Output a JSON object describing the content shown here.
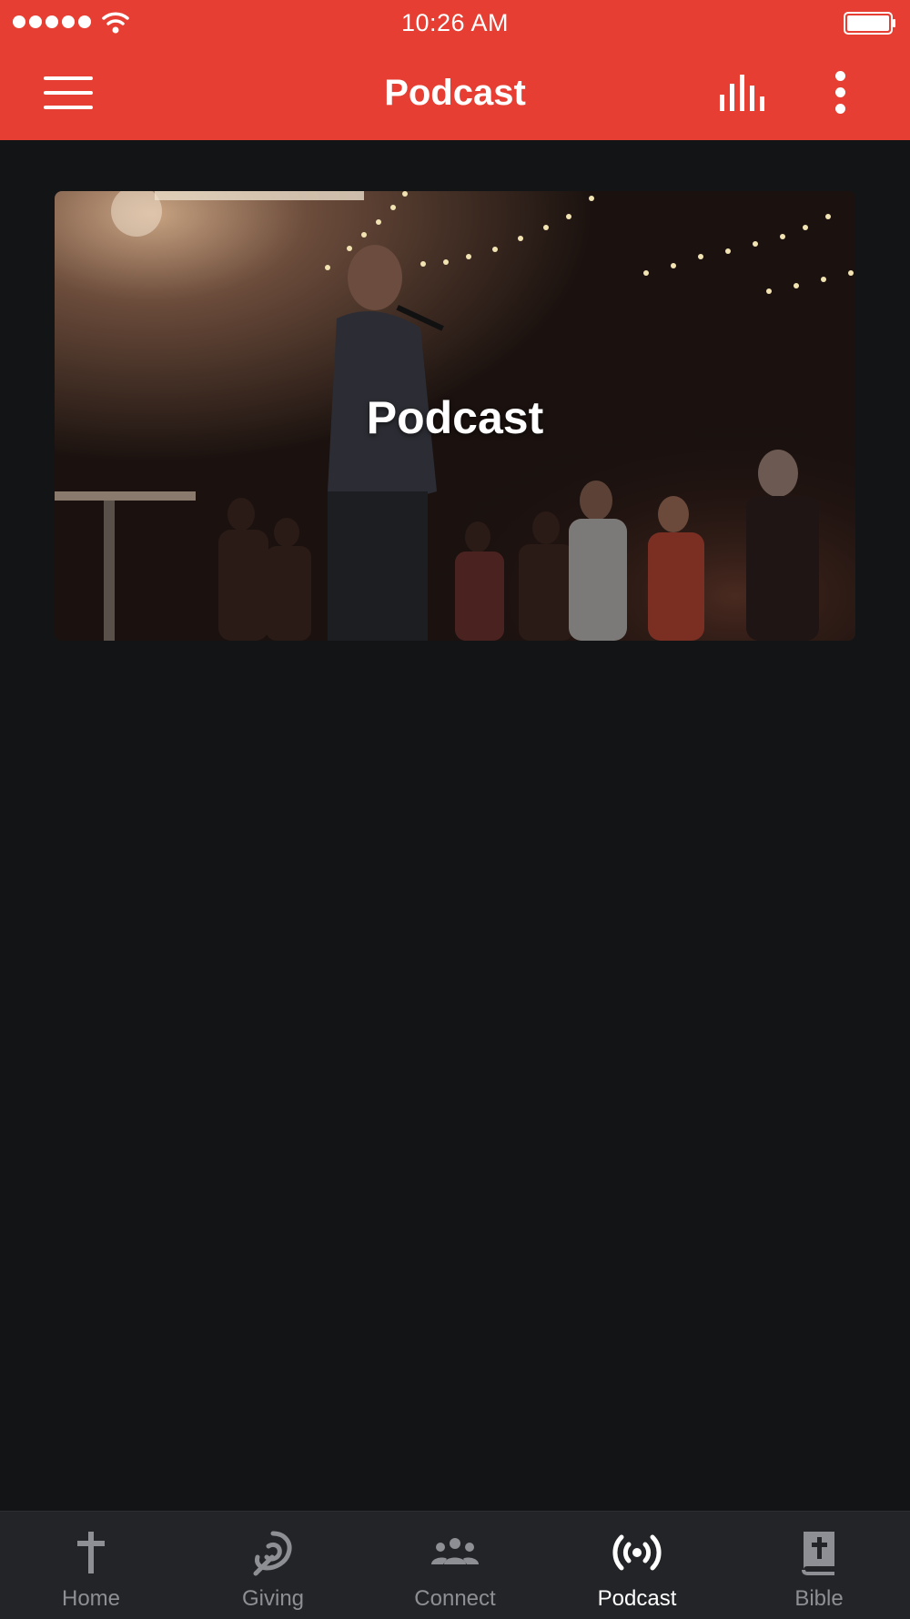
{
  "status_bar": {
    "time": "10:26 AM",
    "signal_icon": "signal-dots-icon",
    "wifi_icon": "wifi-icon",
    "battery_icon": "battery-icon"
  },
  "header": {
    "title": "Podcast",
    "menu_icon": "hamburger-menu-icon",
    "chart_icon": "bar-chart-icon",
    "more_icon": "more-vertical-icon",
    "background_color": "#e63e32"
  },
  "hero": {
    "title": "Podcast"
  },
  "tabs": [
    {
      "label": "Home",
      "icon": "cross-icon",
      "active": false
    },
    {
      "label": "Giving",
      "icon": "giving-icon",
      "active": false
    },
    {
      "label": "Connect",
      "icon": "group-icon",
      "active": false
    },
    {
      "label": "Podcast",
      "icon": "podcast-broadcast-icon",
      "active": true
    },
    {
      "label": "Bible",
      "icon": "bible-icon",
      "active": false
    }
  ],
  "colors": {
    "accent": "#e63e32",
    "background": "#131416",
    "tabbar": "#232427",
    "tab_inactive": "#8d8f94",
    "tab_active": "#ffffff"
  }
}
